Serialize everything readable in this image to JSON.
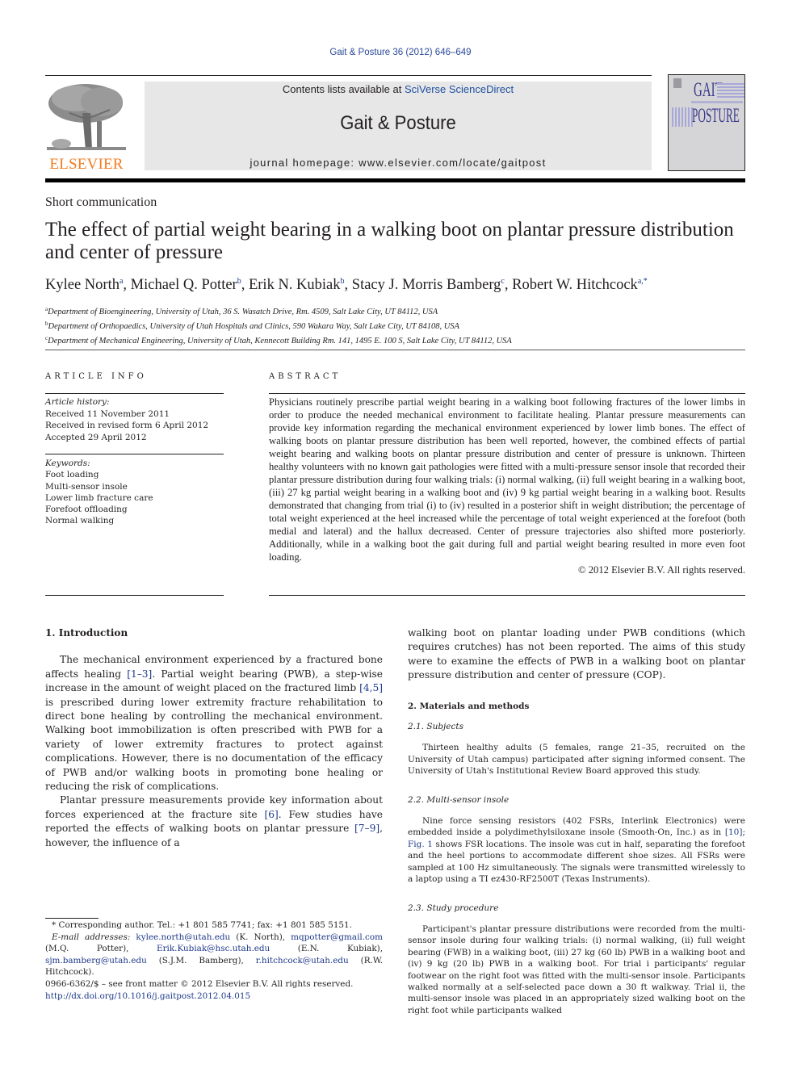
{
  "header": {
    "citation": "Gait & Posture 36 (2012) 646–649",
    "contents_prefix": "Contents lists available at ",
    "contents_link": "SciVerse ScienceDirect",
    "journal_name": "Gait & Posture",
    "homepage": "journal homepage: www.elsevier.com/locate/gaitpost",
    "publisher_logo_text": "ELSEVIER",
    "cover_title_line1": "GAIT",
    "cover_title_line2": "POSTURE",
    "colors": {
      "elsevier_orange": "#f47b20",
      "link_blue": "#1e3a8a",
      "banner_gray": "#e7e7e7"
    }
  },
  "article": {
    "type": "Short communication",
    "title": "The effect of partial weight bearing in a walking boot on plantar pressure distribution and center of pressure",
    "authors": [
      {
        "name": "Kylee North",
        "aff": "a"
      },
      {
        "name": "Michael Q. Potter",
        "aff": "b"
      },
      {
        "name": "Erik N. Kubiak",
        "aff": "b"
      },
      {
        "name": "Stacy J. Morris Bamberg",
        "aff": "c"
      },
      {
        "name": "Robert W. Hitchcock",
        "aff": "a,*"
      }
    ],
    "affiliations": [
      {
        "key": "a",
        "text": "Department of Bioengineering, University of Utah, 36 S. Wasatch Drive, Rm. 4509, Salt Lake City, UT 84112, USA"
      },
      {
        "key": "b",
        "text": "Department of Orthopaedics, University of Utah Hospitals and Clinics, 590 Wakara Way, Salt Lake City, UT 84108, USA"
      },
      {
        "key": "c",
        "text": "Department of Mechanical Engineering, University of Utah, Kennecott Building Rm. 141, 1495 E. 100 S, Salt Lake City, UT 84112, USA"
      }
    ]
  },
  "article_info": {
    "heading": "ARTICLE INFO",
    "history_label": "Article history:",
    "history": [
      "Received 11 November 2011",
      "Received in revised form 6 April 2012",
      "Accepted 29 April 2012"
    ],
    "keywords_label": "Keywords:",
    "keywords": [
      "Foot loading",
      "Multi-sensor insole",
      "Lower limb fracture care",
      "Forefoot offloading",
      "Normal walking"
    ]
  },
  "abstract": {
    "heading": "ABSTRACT",
    "text": "Physicians routinely prescribe partial weight bearing in a walking boot following fractures of the lower limbs in order to produce the needed mechanical environment to facilitate healing. Plantar pressure measurements can provide key information regarding the mechanical environment experienced by lower limb bones. The effect of walking boots on plantar pressure distribution has been well reported, however, the combined effects of partial weight bearing and walking boots on plantar pressure distribution and center of pressure is unknown. Thirteen healthy volunteers with no known gait pathologies were fitted with a multi-pressure sensor insole that recorded their plantar pressure distribution during four walking trials: (i) normal walking, (ii) full weight bearing in a walking boot, (iii) 27 kg partial weight bearing in a walking boot and (iv) 9 kg partial weight bearing in a walking boot. Results demonstrated that changing from trial (i) to (iv) resulted in a posterior shift in weight distribution; the percentage of total weight experienced at the heel increased while the percentage of total weight experienced at the forefoot (both medial and lateral) and the hallux decreased. Center of pressure trajectories also shifted more posteriorly. Additionally, while in a walking boot the gait during full and partial weight bearing resulted in more even foot loading.",
    "copyright": "© 2012 Elsevier B.V. All rights reserved."
  },
  "body": {
    "intro_heading": "1.  Introduction",
    "intro_p1": {
      "t1": "The mechanical environment experienced by a fractured bone affects healing ",
      "r1": "[1–3]",
      "t2": ". Partial weight bearing (PWB), a step-wise increase in the amount of weight placed on the fractured limb ",
      "r2": "[4,5]",
      "t3": " is prescribed during lower extremity fracture rehabilitation to direct bone healing by controlling the mechanical environment. Walking boot immobilization is often prescribed with PWB for a variety of lower extremity fractures to protect against complications. However, there is no documentation of the efficacy of PWB and/or walking boots in promoting bone healing or reducing the risk of complications."
    },
    "intro_p2": {
      "t1": "Plantar pressure measurements provide key information about forces experienced at the fracture site ",
      "r1": "[6]",
      "t2": ". Few studies have reported the effects of walking boots on plantar pressure ",
      "r2": "[7–9]",
      "t3": ", however, the influence of a walking boot on plantar loading under PWB conditions (which requires crutches) has not been reported. The aims of this study were to examine the effects of PWB in a walking boot on plantar pressure distribution and center of pressure (COP)."
    },
    "methods_heading": "2.  Materials and methods",
    "subjects_heading": "2.1.  Subjects",
    "subjects_text": "Thirteen healthy adults (5 females, range 21–35, recruited on the University of Utah campus) participated after signing informed consent. The University of Utah's Institutional Review Board approved this study.",
    "insole_heading": "2.2.  Multi-sensor insole",
    "insole_p": {
      "t1": "Nine force sensing resistors (402 FSRs, Interlink Electronics) were embedded inside a polydimethylsiloxane insole (Smooth-On, Inc.) as in ",
      "r1": "[10]",
      "t2": "; ",
      "r2": "Fig. 1",
      "t3": " shows FSR locations. The insole was cut in half, separating the forefoot and the heel portions to accommodate different shoe sizes. All FSRs were sampled at 100 Hz simultaneously. The signals were transmitted wirelessly to a laptop using a TI ez430-RF2500T (Texas Instruments)."
    },
    "procedure_heading": "2.3.  Study procedure",
    "procedure_text": "Participant's plantar pressure distributions were recorded from the multi-sensor insole during four walking trials: (i) normal walking, (ii) full weight bearing (FWB) in a walking boot, (iii) 27 kg (60 lb) PWB in a walking boot and (iv) 9 kg (20 lb) PWB in a walking boot. For trial i participants' regular footwear on the right foot was fitted with the multi-sensor insole. Participants walked normally at a self-selected pace down a 30 ft walkway. Trial ii, the multi-sensor insole was placed in an appropriately sized walking boot on the right foot while participants walked"
  },
  "footnotes": {
    "corresponding": "* Corresponding author. Tel.: +1 801 585 7741; fax: +1 801 585 5151.",
    "email_label": "E-mail addresses:",
    "emails": [
      {
        "email": "kylee.north@utah.edu",
        "who": " (K. North), "
      },
      {
        "email": "mqpotter@gmail.com",
        "who": " (M.Q. Potter), "
      },
      {
        "email": "Erik.Kubiak@hsc.utah.edu",
        "who": " (E.N. Kubiak), "
      },
      {
        "email": "sjm.bamberg@utah.edu",
        "who": " (S.J.M. Bamberg), "
      },
      {
        "email": "r.hitchcock@utah.edu",
        "who": " (R.W. Hitchcock)."
      }
    ],
    "issn": "0966-6362/$ – see front matter © 2012 Elsevier B.V. All rights reserved.",
    "doi": "http://dx.doi.org/10.1016/j.gaitpost.2012.04.015"
  }
}
